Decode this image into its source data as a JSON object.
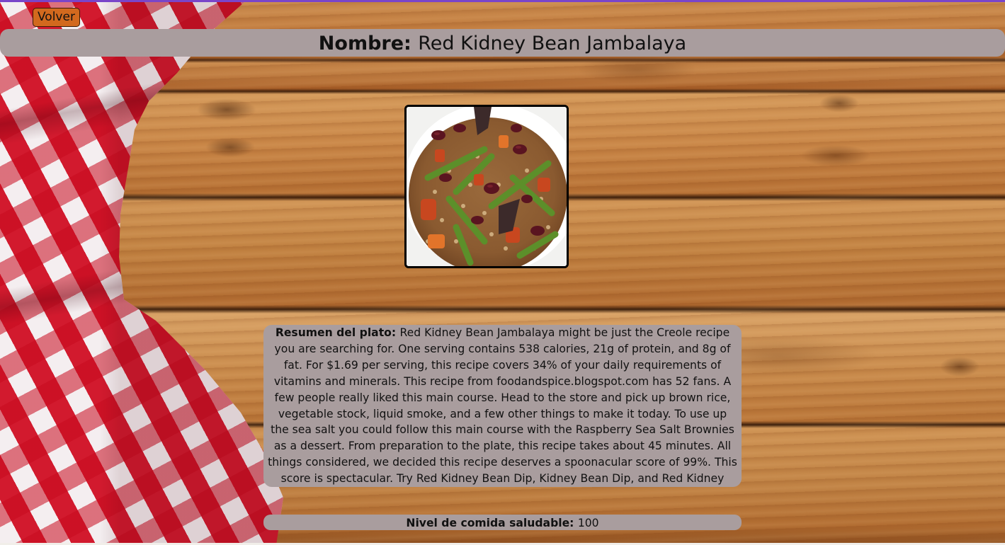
{
  "nav": {
    "back_label": "Volver"
  },
  "recipe": {
    "name_label": "Nombre:",
    "name": "Red Kidney Bean Jambalaya",
    "image_alt": "Red Kidney Bean Jambalaya dish photo",
    "summary_label": "Resumen del plato:",
    "summary": "Red Kidney Bean Jambalaya might be just the Creole recipe you are searching for. One serving contains 538 calories, 21g of protein, and 8g of fat. For $1.69 per serving, this recipe covers 34% of your daily requirements of vitamins and minerals. This recipe from foodandspice.blogspot.com has 52 fans. A few people really liked this main course. Head to the store and pick up brown rice, vegetable stock, liquid smoke, and a few other things to make it today. To use up the sea salt you could follow this main course with the Raspberry Sea Salt Brownies as a dessert. From preparation to the plate, this recipe takes about 45 minutes. All things considered, we decided this recipe deserves a spoonacular score of 99%. This score is spectacular. Try Red Kidney Bean Dip, Kidney Bean Dip, and Red Kidney Bean Curry for similar recipes.",
    "health_label": "Nivel de comida saludable:",
    "health_score": "100"
  },
  "colors": {
    "panel": "#a99d9e",
    "back_button": "#d2691e",
    "accent_top": "#7a45c9"
  }
}
